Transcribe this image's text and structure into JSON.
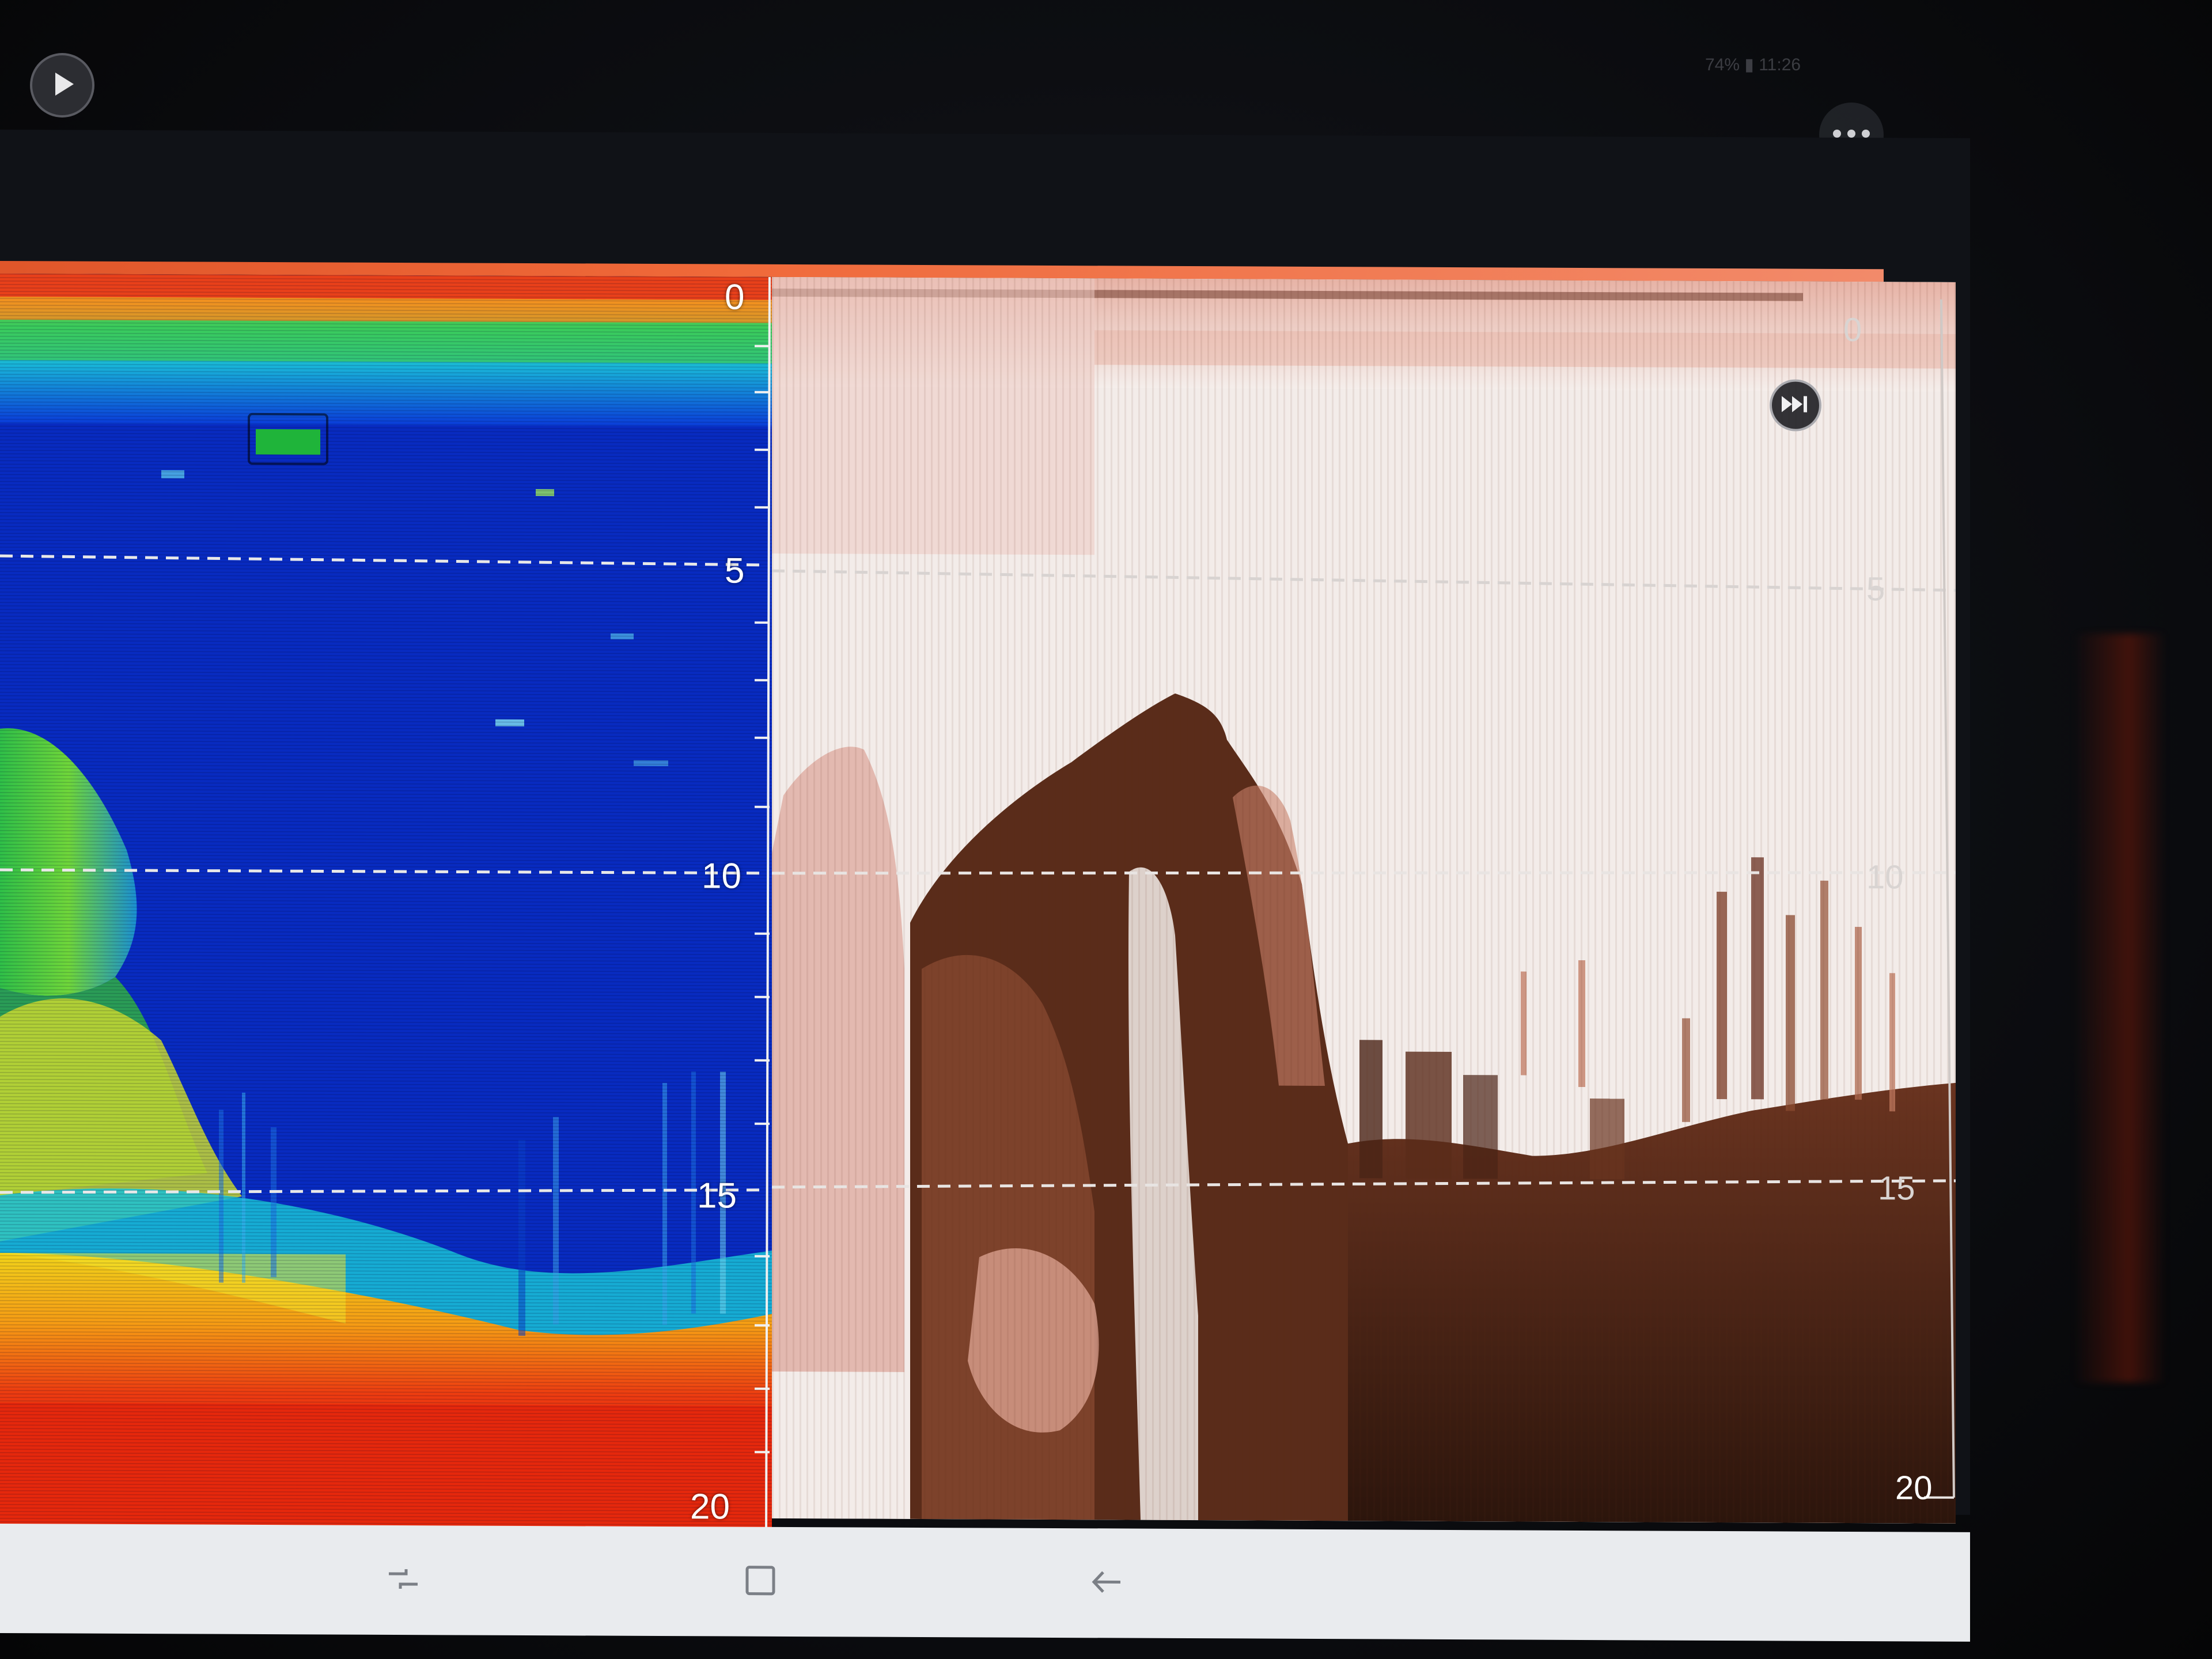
{
  "screen": {
    "status_text": "74% ▮ 11:26"
  },
  "left_panel": {
    "palette": "color",
    "depth_scale": {
      "labels": [
        "0",
        "5",
        "10",
        "15",
        "20"
      ],
      "values": [
        0,
        5,
        10,
        15,
        20
      ]
    }
  },
  "right_panel": {
    "palette": "sepia",
    "depth_scale": {
      "labels": [
        "0",
        "5",
        "10",
        "15",
        "20"
      ],
      "values": [
        0,
        5,
        10,
        15,
        20
      ]
    }
  },
  "icons": {
    "play": "play-icon",
    "more": "more-icon",
    "fast_forward": "fast-forward-icon",
    "recents": "recents-icon",
    "home": "home-icon",
    "back": "back-icon"
  },
  "colors": {
    "accent_orange": "#f06a3a",
    "deep_blue": "#0a2fd0",
    "bottom_red": "#e8260e",
    "sepia_dark": "#3a1e12",
    "sepia_light": "#f3ece9"
  }
}
